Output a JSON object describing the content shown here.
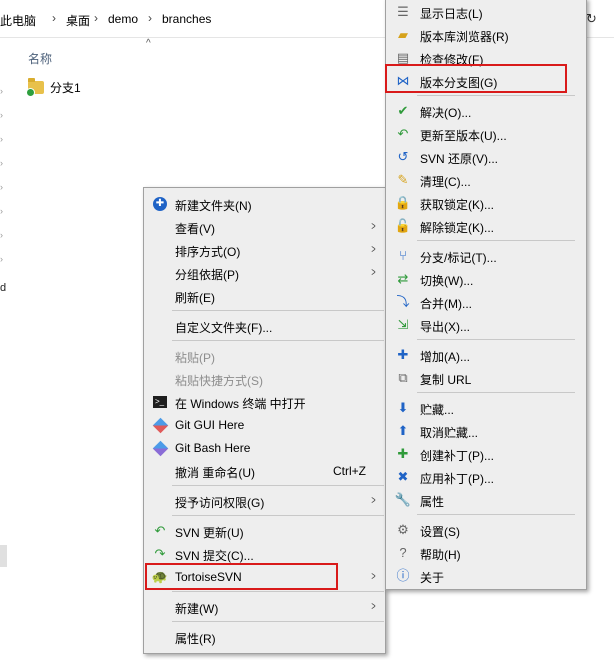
{
  "address_bar": {
    "crumbs": [
      "此电脑",
      "桌面",
      "demo",
      "branches"
    ],
    "separator": "›"
  },
  "file_list": {
    "column_header": "名称",
    "items": [
      {
        "name": "分支1"
      }
    ]
  },
  "left_pane": {
    "stray_text": "d"
  },
  "explorer_menu": {
    "items": [
      {
        "label": "新建文件夹(N)",
        "icon": "new-folder-icon"
      },
      {
        "label": "查看(V)",
        "submenu": true
      },
      {
        "label": "排序方式(O)",
        "submenu": true
      },
      {
        "label": "分组依据(P)",
        "submenu": true
      },
      {
        "label": "刷新(E)"
      },
      {
        "label": "自定义文件夹(F)..."
      },
      {
        "label": "粘贴(P)",
        "disabled": true
      },
      {
        "label": "粘贴快捷方式(S)",
        "disabled": true
      },
      {
        "label": "在 Windows 终端 中打开",
        "icon": "terminal-icon"
      },
      {
        "label": "Git GUI Here",
        "icon": "git-gui-icon"
      },
      {
        "label": "Git Bash Here",
        "icon": "git-bash-icon"
      },
      {
        "label": "撤消 重命名(U)",
        "shortcut": "Ctrl+Z"
      },
      {
        "label": "授予访问权限(G)",
        "submenu": true
      },
      {
        "label": "SVN 更新(U)",
        "icon": "svn-update-icon"
      },
      {
        "label": "SVN 提交(C)...",
        "icon": "svn-commit-icon"
      },
      {
        "label": "TortoiseSVN",
        "icon": "tortoisesvn-icon",
        "submenu": true,
        "highlighted": true
      },
      {
        "label": "新建(W)",
        "submenu": true
      },
      {
        "label": "属性(R)"
      }
    ]
  },
  "tortoise_menu": {
    "items": [
      {
        "label": "显示日志(L)",
        "icon": "show-log-icon"
      },
      {
        "label": "版本库浏览器(R)",
        "icon": "repo-browser-icon"
      },
      {
        "label": "检查修改(F)",
        "icon": "check-modifications-icon"
      },
      {
        "label": "版本分支图(G)",
        "icon": "revision-graph-icon",
        "highlighted": true
      },
      {
        "label": "解决(O)...",
        "icon": "resolve-icon"
      },
      {
        "label": "更新至版本(U)...",
        "icon": "update-to-revision-icon"
      },
      {
        "label": "SVN 还原(V)...",
        "icon": "revert-icon"
      },
      {
        "label": "清理(C)...",
        "icon": "cleanup-icon"
      },
      {
        "label": "获取锁定(K)...",
        "icon": "get-lock-icon"
      },
      {
        "label": "解除锁定(K)...",
        "icon": "release-lock-icon"
      },
      {
        "label": "分支/标记(T)...",
        "icon": "branch-tag-icon"
      },
      {
        "label": "切换(W)...",
        "icon": "switch-icon"
      },
      {
        "label": "合并(M)...",
        "icon": "merge-icon"
      },
      {
        "label": "导出(X)...",
        "icon": "export-icon"
      },
      {
        "label": "增加(A)...",
        "icon": "add-icon"
      },
      {
        "label": "复制 URL",
        "icon": "copy-url-icon"
      },
      {
        "label": "贮藏...",
        "icon": "shelve-icon"
      },
      {
        "label": "取消贮藏...",
        "icon": "unshelve-icon"
      },
      {
        "label": "创建补丁(P)...",
        "icon": "create-patch-icon"
      },
      {
        "label": "应用补丁(P)...",
        "icon": "apply-patch-icon"
      },
      {
        "label": "属性",
        "icon": "properties-icon"
      },
      {
        "label": "设置(S)",
        "icon": "settings-icon"
      },
      {
        "label": "帮助(H)",
        "icon": "help-icon"
      },
      {
        "label": "关于",
        "icon": "about-icon"
      }
    ]
  },
  "colors": {
    "highlight_box": "#d91a1a",
    "menu_bg": "#eeeeee"
  }
}
